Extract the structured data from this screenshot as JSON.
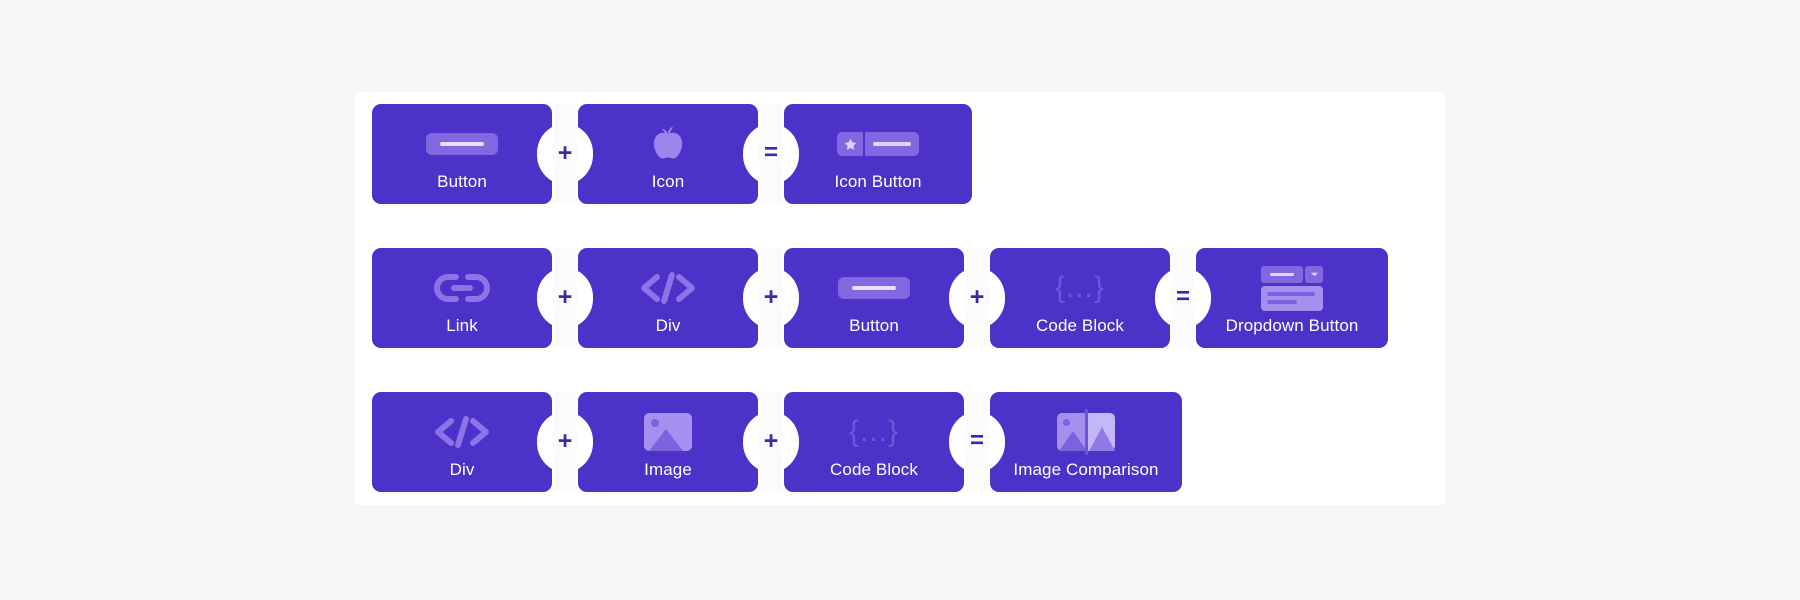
{
  "page": {
    "background_color": "#f6f6f7",
    "panel_color": "#ffffff",
    "card_color": "#4c32c8",
    "glyph_color": "#9b87ec",
    "operator_symbol_color": "#3a2aa8"
  },
  "rows": [
    {
      "id": "row-icon-button",
      "items": [
        {
          "kind": "card",
          "label": "Button",
          "icon": "button-bar-icon"
        },
        {
          "kind": "op",
          "label": "+",
          "icon": "plus-icon"
        },
        {
          "kind": "card",
          "label": "Icon",
          "icon": "apple-icon"
        },
        {
          "kind": "op",
          "label": "=",
          "icon": "equals-icon"
        },
        {
          "kind": "card",
          "label": "Icon Button",
          "icon": "icon-button-icon"
        }
      ]
    },
    {
      "id": "row-dropdown-button",
      "items": [
        {
          "kind": "card",
          "label": "Link",
          "icon": "link-chain-icon"
        },
        {
          "kind": "op",
          "label": "+",
          "icon": "plus-icon"
        },
        {
          "kind": "card",
          "label": "Div",
          "icon": "code-tags-icon"
        },
        {
          "kind": "op",
          "label": "+",
          "icon": "plus-icon"
        },
        {
          "kind": "card",
          "label": "Button",
          "icon": "button-bar-icon"
        },
        {
          "kind": "op",
          "label": "+",
          "icon": "plus-icon"
        },
        {
          "kind": "card",
          "label": "Code Block",
          "icon": "curly-braces-icon"
        },
        {
          "kind": "op",
          "label": "=",
          "icon": "equals-icon"
        },
        {
          "kind": "card",
          "label": "Dropdown Button",
          "icon": "dropdown-button-icon"
        }
      ]
    },
    {
      "id": "row-image-comparison",
      "items": [
        {
          "kind": "card",
          "label": "Div",
          "icon": "code-tags-icon"
        },
        {
          "kind": "op",
          "label": "+",
          "icon": "plus-icon"
        },
        {
          "kind": "card",
          "label": "Image",
          "icon": "image-photo-icon"
        },
        {
          "kind": "op",
          "label": "+",
          "icon": "plus-icon"
        },
        {
          "kind": "card",
          "label": "Code Block",
          "icon": "curly-braces-icon"
        },
        {
          "kind": "op",
          "label": "=",
          "icon": "equals-icon"
        },
        {
          "kind": "card",
          "label": "Image Comparison",
          "icon": "image-comparison-icon"
        }
      ]
    }
  ],
  "glyph_text": {
    "code_tags": "</>",
    "curly_braces": "{...}"
  }
}
